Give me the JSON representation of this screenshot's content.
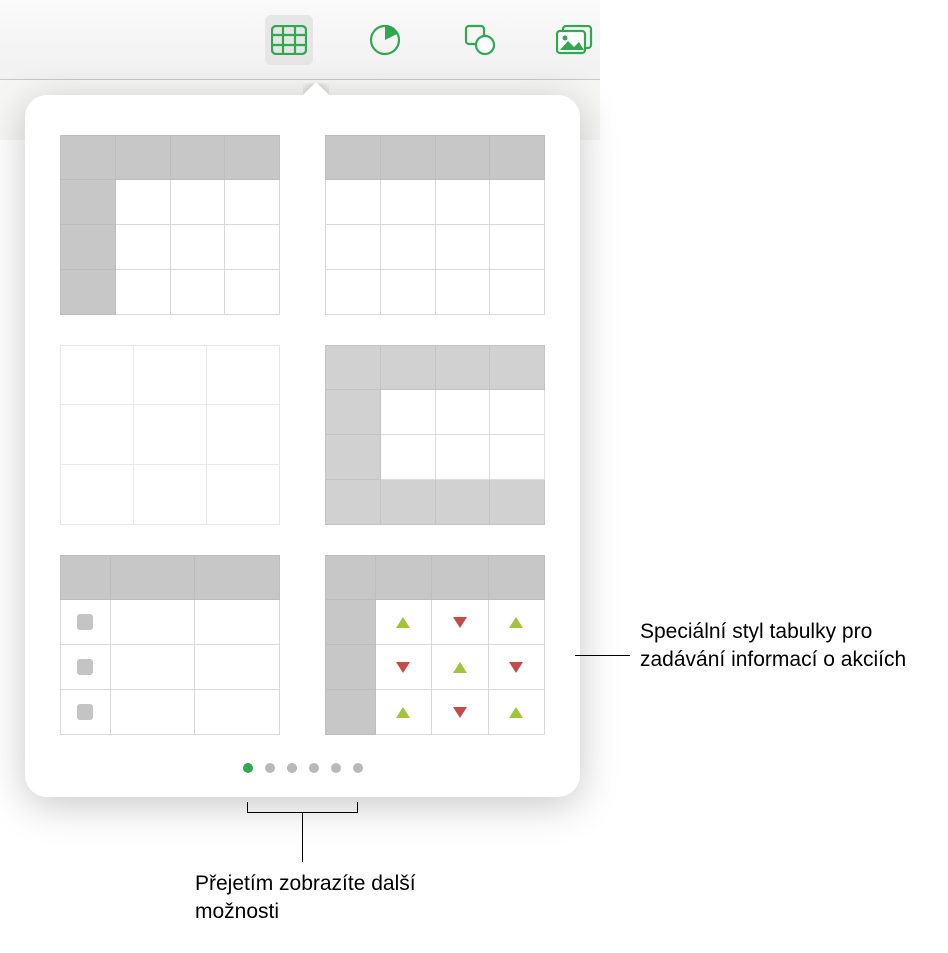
{
  "toolbar": {
    "table_icon": "table",
    "chart_icon": "chart",
    "shape_icon": "shape",
    "media_icon": "media"
  },
  "pager": {
    "total": 6,
    "active_index": 0
  },
  "callouts": {
    "stock_style": "Speciální styl tabulky pro zadávání informací o akciích",
    "swipe_hint": "Přejetím zobrazíte další možnosti"
  },
  "chart_data": null
}
